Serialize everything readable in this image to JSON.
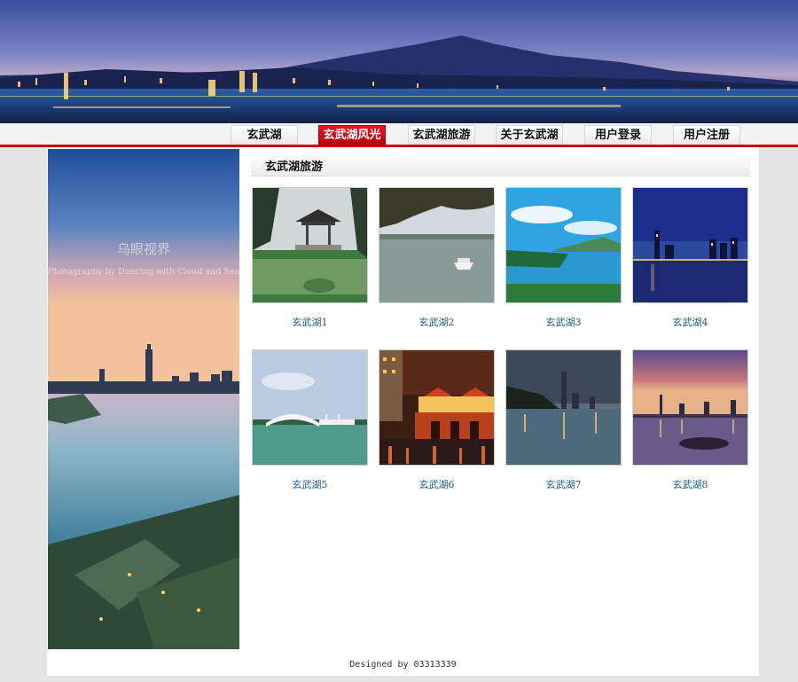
{
  "nav": {
    "items": [
      {
        "label": "玄武湖",
        "active": false
      },
      {
        "label": "玄武湖风光",
        "active": true
      },
      {
        "label": "玄武湖旅游",
        "active": false
      },
      {
        "label": "关于玄武湖",
        "active": false
      },
      {
        "label": "用户登录",
        "active": false
      },
      {
        "label": "用户注册",
        "active": false
      }
    ]
  },
  "side": {
    "watermark_title": "乌眼视界",
    "watermark_sub": "Photography by Dancing with Cloud and Sea"
  },
  "content": {
    "title": "玄武湖旅游",
    "gallery": [
      {
        "caption": "玄武湖1"
      },
      {
        "caption": "玄武湖2"
      },
      {
        "caption": "玄武湖3"
      },
      {
        "caption": "玄武湖4"
      },
      {
        "caption": "玄武湖5"
      },
      {
        "caption": "玄武湖6"
      },
      {
        "caption": "玄武湖7"
      },
      {
        "caption": "玄武湖8"
      }
    ]
  },
  "footer": {
    "text": "Designed by 03313339"
  },
  "colors": {
    "accent_red": "#c8000a",
    "caption_blue": "#1d5d8f"
  }
}
